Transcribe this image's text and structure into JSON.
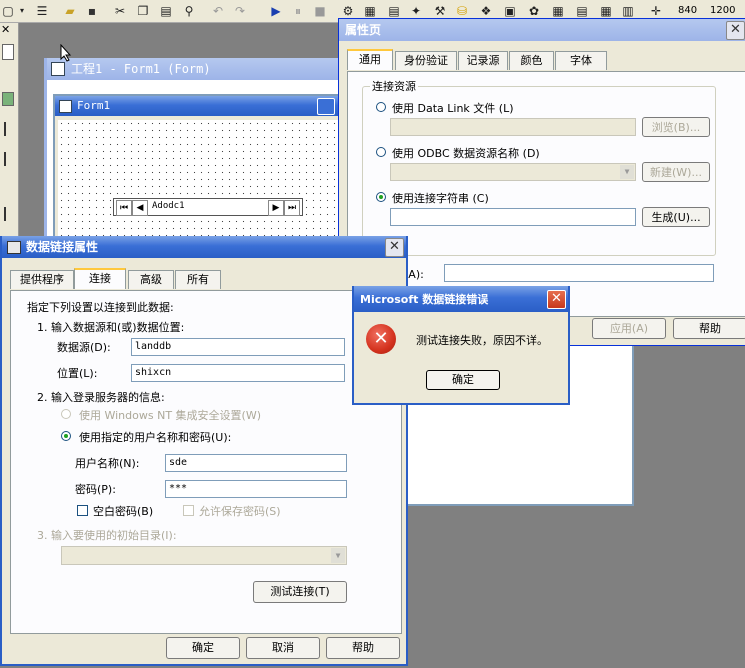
{
  "toolbar": {
    "coords": [
      "840",
      "1200"
    ],
    "icons": [
      "add-form-icon",
      "menu-editor-icon",
      "open-icon",
      "save-icon",
      "cut-icon",
      "copy-icon",
      "paste-icon",
      "find-icon",
      "undo-icon",
      "redo-icon",
      "run-icon",
      "pause-icon",
      "stop-icon",
      "project-explorer-icon",
      "properties-icon",
      "form-layout-icon",
      "object-browser-icon",
      "toolbox-icon",
      "data-view-icon",
      "component-manager-icon"
    ]
  },
  "project_window": {
    "title": "工程1 - Form1 (Form)"
  },
  "form": {
    "title": "Form1",
    "adodc_label": "Adodc1"
  },
  "property_pages": {
    "title": "属性页",
    "tabs": [
      "通用",
      "身份验证",
      "记录源",
      "颜色",
      "字体"
    ],
    "group_title": "连接资源",
    "options": {
      "datalink": "使用 Data Link 文件 (L)",
      "odbc": "使用 ODBC 数据资源名称 (D)",
      "connstr": "使用连接字符串 (C)"
    },
    "buttons": {
      "browse": "浏览(B)...",
      "new": "新建(W)...",
      "build": "生成(U)...",
      "apply": "应用(A)",
      "help": "帮助"
    },
    "other_label": "(A):"
  },
  "data_link": {
    "title": "数据链接属性",
    "tabs": [
      "提供程序",
      "连接",
      "高级",
      "所有"
    ],
    "instruction": "指定下列设置以连接到此数据:",
    "step1": "1. 输入数据源和(或)数据位置:",
    "datasource_label": "数据源(D):",
    "datasource_value": "landdb",
    "location_label": "位置(L):",
    "location_value": "shixcn",
    "step2": "2. 输入登录服务器的信息:",
    "nt_security": "使用 Windows NT 集成安全设置(W)",
    "specific_user": "使用指定的用户名称和密码(U):",
    "username_label": "用户名称(N):",
    "username_value": "sde",
    "password_label": "密码(P):",
    "password_value": "***",
    "blank_password": "空白密码(B)",
    "allow_save": "允许保存密码(S)",
    "step3": "3. 输入要使用的初始目录(I):",
    "test_button": "测试连接(T)",
    "ok": "确定",
    "cancel": "取消",
    "help": "帮助"
  },
  "error_dialog": {
    "title": "Microsoft 数据链接错误",
    "message": "测试连接失败，原因不详。",
    "ok": "确定"
  },
  "colors": {
    "titlebar": "#2a5ec6",
    "face": "#ece9d8",
    "error_red": "#d4321e"
  }
}
